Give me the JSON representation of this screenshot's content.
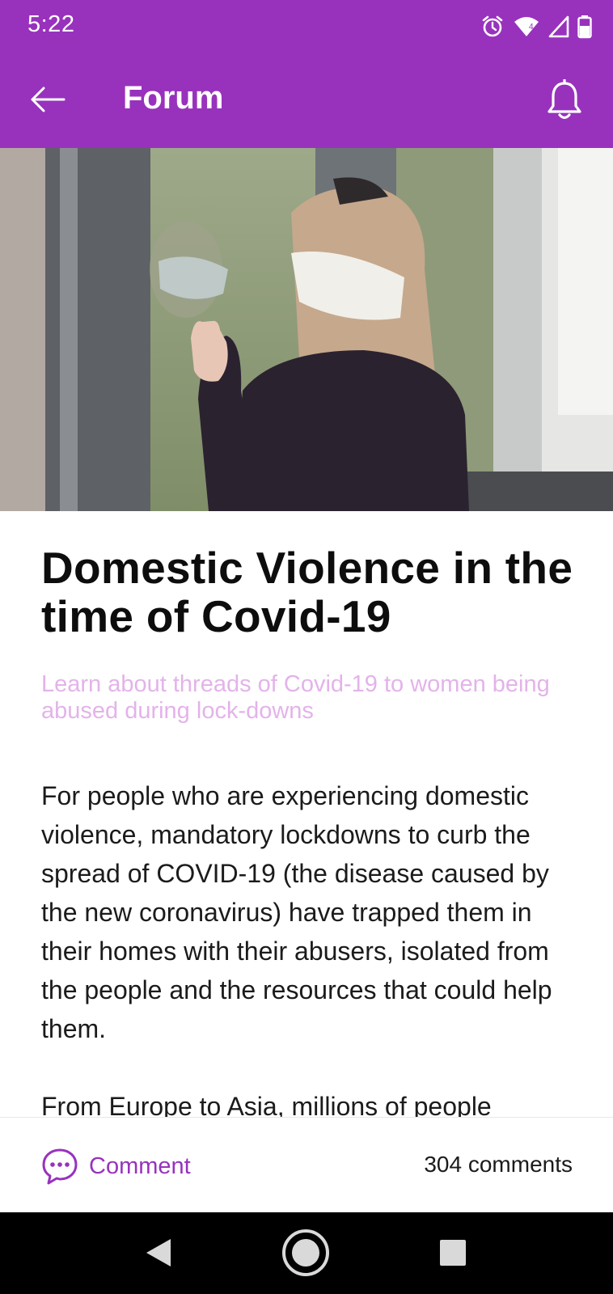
{
  "status_bar": {
    "time": "5:22",
    "icons": [
      "alarm-icon",
      "wifi-icon",
      "signal-icon",
      "battery-icon"
    ],
    "wifi_badge": "4"
  },
  "app_bar": {
    "title": "Forum",
    "back_icon": "arrow-left-icon",
    "notification_icon": "bell-icon",
    "color": "#9832bd"
  },
  "article": {
    "image_description_icon": "hero-photo",
    "headline": "Domestic Violence in the time of Covid-19",
    "subheadline": "Learn about threads of Covid-19 to women being abused during lock-downs",
    "paragraph_1": "For people who are experiencing domestic violence, mandatory lockdowns to curb the spread of COVID-19 (the disease caused by the new coronavirus) have trapped them in their homes with their abusers, isolated from the people and the resources that could help them.",
    "paragraph_2": "From Europe to Asia, millions of people"
  },
  "actions": {
    "comment_label": "Comment",
    "comment_icon": "chat-bubble-icon",
    "comment_count": "304 comments"
  },
  "navigation_bar": {
    "buttons": [
      "back-triangle-icon",
      "home-circle-icon",
      "recents-square-icon"
    ]
  }
}
